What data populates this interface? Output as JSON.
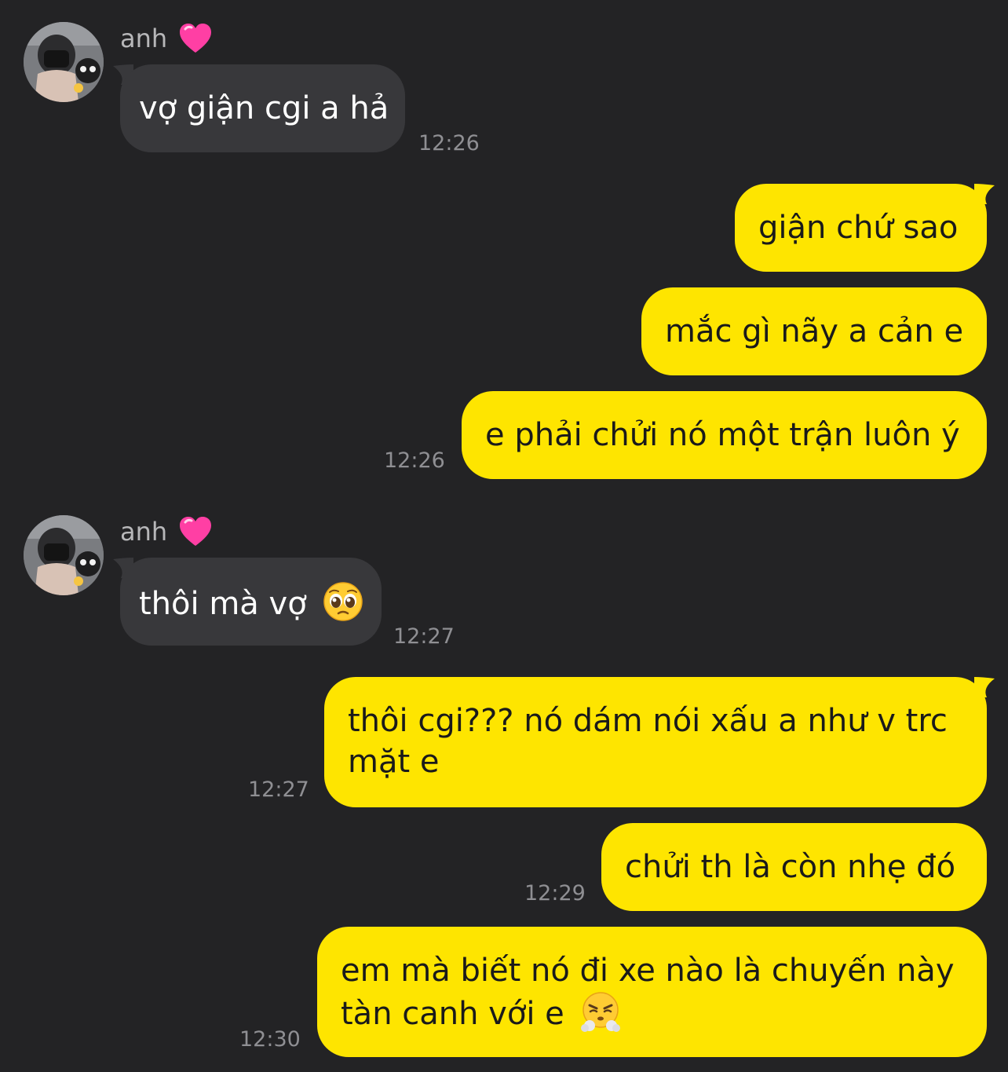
{
  "colors": {
    "background": "#232325",
    "incoming_bubble": "#38383b",
    "outgoing_bubble": "#fee500",
    "timestamp": "#8f8f93"
  },
  "groups": [
    {
      "sender": "anh",
      "sender_icon": "heart-icon",
      "messages": [
        {
          "text": "vợ giận cgi a hả",
          "time": "12:26"
        }
      ]
    },
    {
      "outgoing": true,
      "messages": [
        {
          "text": "giận chứ sao"
        },
        {
          "text": "mắc gì nãy a cản e"
        },
        {
          "text": "e phải chửi nó một trận luôn ý",
          "time": "12:26"
        }
      ]
    },
    {
      "sender": "anh",
      "sender_icon": "heart-icon",
      "messages": [
        {
          "text": "thôi mà vợ",
          "emoji": "pleading-face-emoji",
          "time": "12:27"
        }
      ]
    },
    {
      "outgoing": true,
      "messages": [
        {
          "text": "thôi cgi??? nó dám nói xấu a như v trc mặt e",
          "time": "12:27"
        },
        {
          "text": "chửi th là còn nhẹ đó",
          "time": "12:29"
        },
        {
          "text": "em mà biết nó đi xe nào là chuyến này tàn canh với e",
          "emoji": "face-with-steam-emoji",
          "time": "12:30"
        }
      ]
    }
  ]
}
